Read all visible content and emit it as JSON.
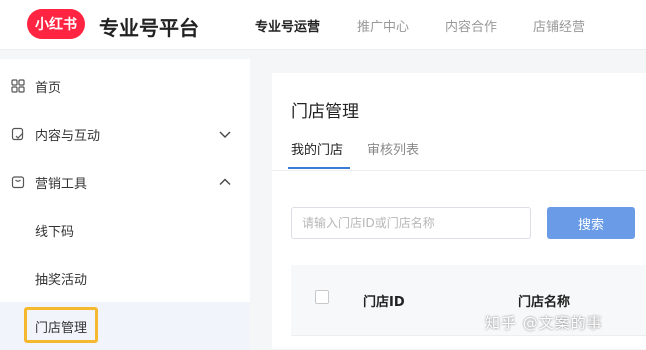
{
  "header": {
    "logo_text": "小红书",
    "brand_title": "专业号平台",
    "nav": [
      "专业号运营",
      "推广中心",
      "内容合作",
      "店铺经营"
    ]
  },
  "sidebar": {
    "items": [
      {
        "label": "首页",
        "icon": "grid-icon"
      },
      {
        "label": "内容与互动",
        "icon": "content-icon",
        "chevron": "down"
      },
      {
        "label": "营销工具",
        "icon": "bag-icon",
        "chevron": "up"
      }
    ],
    "subitems": [
      "线下码",
      "抽奖活动",
      "门店管理"
    ],
    "highlight_color": "#f5b82e"
  },
  "main": {
    "title": "门店管理",
    "tabs": [
      "我的门店",
      "审核列表"
    ],
    "search": {
      "placeholder": "请输入门店ID或门店名称",
      "button": "搜索"
    },
    "table": {
      "columns": [
        "门店ID",
        "门店名称"
      ]
    }
  },
  "watermark": "知乎 @文案的事",
  "colors": {
    "brand_red": "#ff2442",
    "accent_blue": "#3a7bd5",
    "button_blue": "#6a9be6"
  }
}
